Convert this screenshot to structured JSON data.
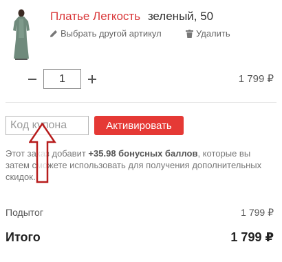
{
  "product": {
    "name": "Платье Легкость",
    "variant": "зеленый, 50",
    "change_label": "Выбрать другой артикул",
    "remove_label": "Удалить",
    "image_icon": "dress-photo",
    "quantity": "1",
    "line_price": "1 799 ₽"
  },
  "coupon": {
    "placeholder": "Код купона",
    "button_label": "Активировать"
  },
  "bonus": {
    "prefix": "Этот заказ добавит ",
    "amount": "+35.98 бонусных баллов",
    "suffix": ", которые вы затем сможете использовать для получения дополнительных скидок."
  },
  "summary": {
    "subtotal_label": "Подытог",
    "subtotal_value": "1 799 ₽",
    "total_label": "Итого",
    "total_value": "1 799 ₽"
  },
  "colors": {
    "accent": "#e53935",
    "link_red": "#d9383a",
    "annotation_arrow": "#b71c1c"
  }
}
